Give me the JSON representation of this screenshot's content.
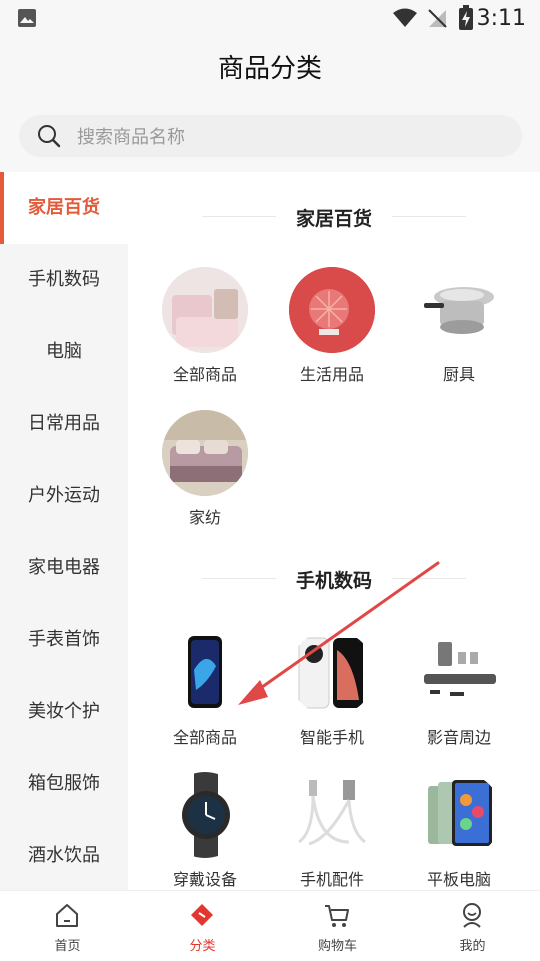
{
  "status_bar": {
    "time": "3:11"
  },
  "header": {
    "title": "商品分类"
  },
  "search": {
    "placeholder": "搜索商品名称"
  },
  "sidebar": {
    "items": [
      {
        "label": "家居百货",
        "active": true
      },
      {
        "label": "手机数码"
      },
      {
        "label": "电脑"
      },
      {
        "label": "日常用品"
      },
      {
        "label": "户外运动"
      },
      {
        "label": "家电电器"
      },
      {
        "label": "手表首饰"
      },
      {
        "label": "美妆个护"
      },
      {
        "label": "箱包服饰"
      },
      {
        "label": "酒水饮品"
      }
    ]
  },
  "sections": [
    {
      "title": "家居百货",
      "items": [
        {
          "label": "全部商品",
          "image": "bedding-photo"
        },
        {
          "label": "生活用品",
          "image": "fan-heater-photo"
        },
        {
          "label": "厨具",
          "image": "cookware-photo"
        },
        {
          "label": "家纺",
          "image": "bedroom-photo"
        }
      ]
    },
    {
      "title": "手机数码",
      "items": [
        {
          "label": "全部商品",
          "image": "phone-photo"
        },
        {
          "label": "智能手机",
          "image": "smartphone-photo"
        },
        {
          "label": "影音周边",
          "image": "soundbar-photo"
        },
        {
          "label": "穿戴设备",
          "image": "smartwatch-photo"
        },
        {
          "label": "手机配件",
          "image": "cable-photo"
        },
        {
          "label": "平板电脑",
          "image": "tablet-photo"
        }
      ]
    }
  ],
  "tabbar": {
    "tabs": [
      {
        "label": "首页",
        "icon": "home-icon"
      },
      {
        "label": "分类",
        "icon": "category-icon",
        "active": true
      },
      {
        "label": "购物车",
        "icon": "cart-icon"
      },
      {
        "label": "我的",
        "icon": "profile-icon"
      }
    ]
  },
  "colors": {
    "accent": "#e35b3a",
    "tab_active": "#e3362e",
    "annotation_arrow": "#e04848"
  }
}
